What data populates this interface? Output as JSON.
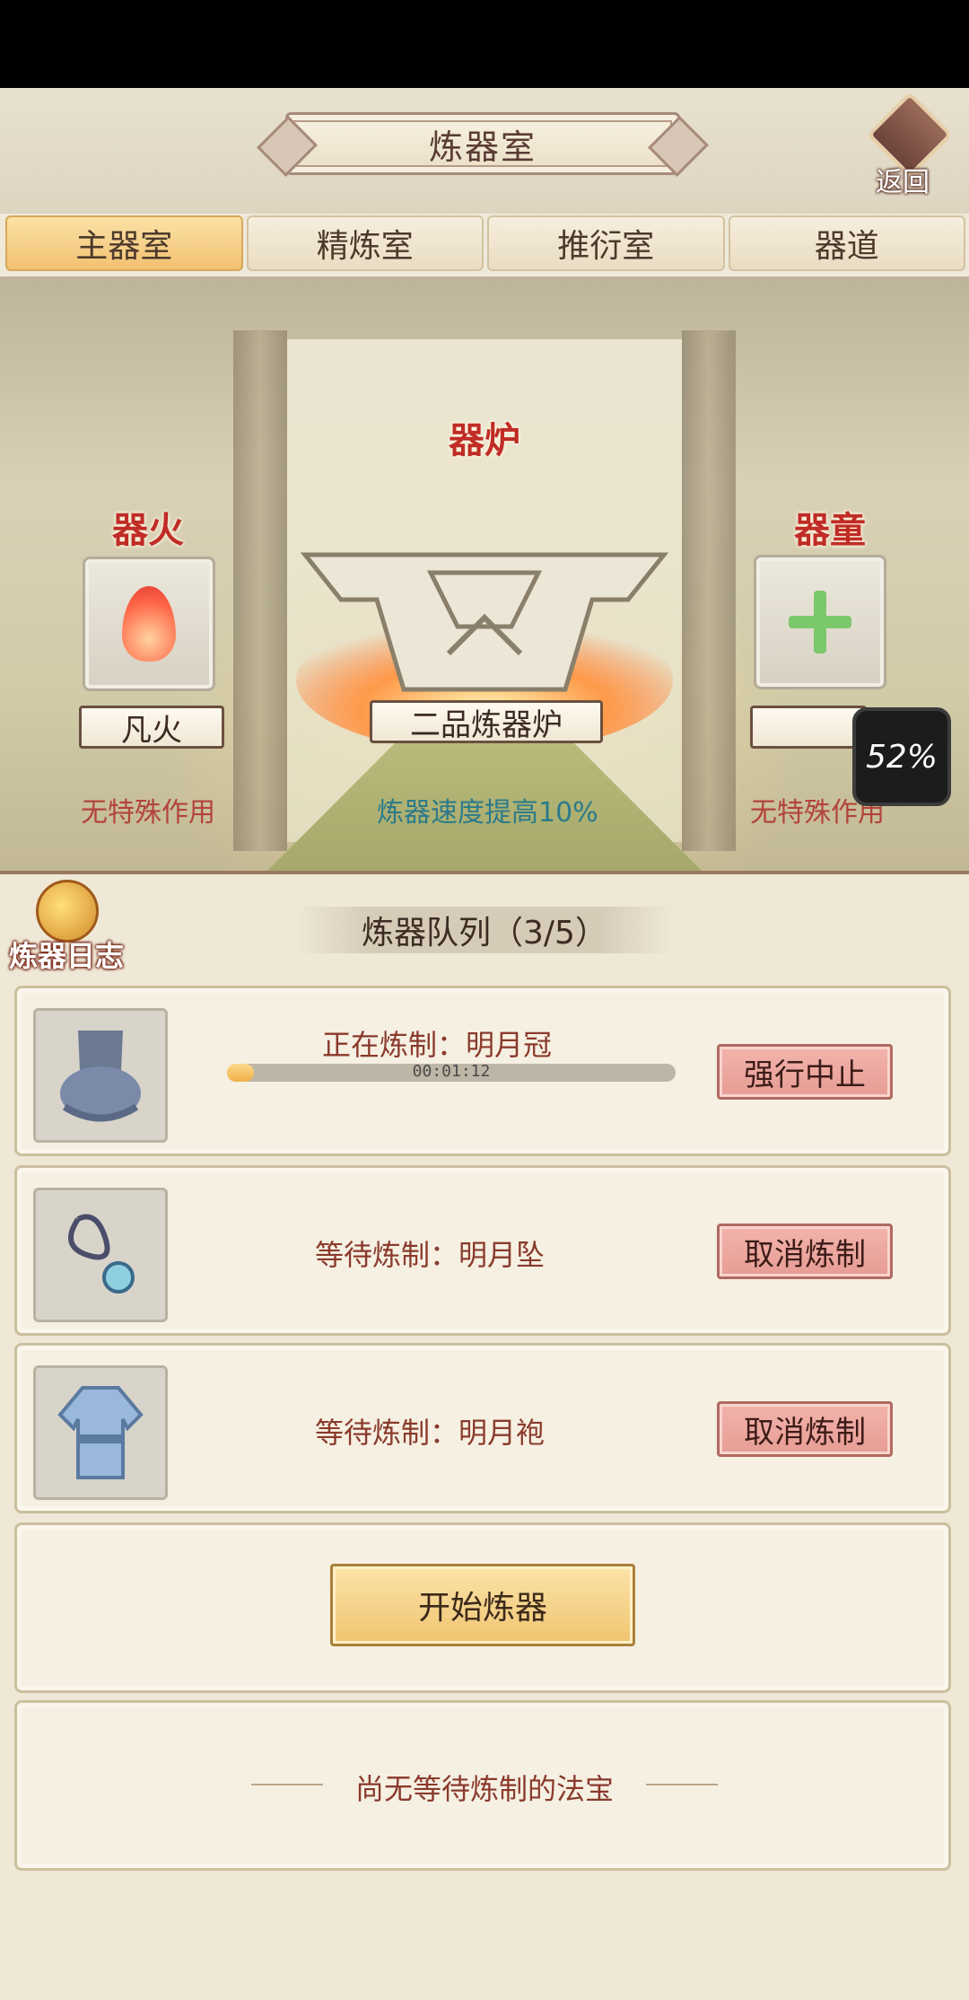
{
  "header": {
    "title": "炼器室",
    "back_label": "返回"
  },
  "tabs": [
    {
      "label": "主器室",
      "active": true
    },
    {
      "label": "精炼室",
      "active": false
    },
    {
      "label": "推衍室",
      "active": false
    },
    {
      "label": "器道",
      "active": false
    }
  ],
  "scene": {
    "fire": {
      "heading": "器火",
      "name": "凡火",
      "effect": "无特殊作用"
    },
    "furnace": {
      "heading": "器炉",
      "name": "二品炼器炉",
      "effect": "炼器速度提高10%"
    },
    "servant": {
      "heading": "器童",
      "name": "",
      "effect": "无特殊作用"
    }
  },
  "overlay_badge": "52%",
  "log": {
    "label": "炼器日志"
  },
  "queue": {
    "title": "炼器队列（3/5）",
    "items": [
      {
        "status": "正在炼制：明月冠",
        "timer": "00:01:12",
        "progress": 0.06,
        "button": "强行中止",
        "icon": "hat-icon"
      },
      {
        "status": "等待炼制：明月坠",
        "button": "取消炼制",
        "icon": "pendant-icon"
      },
      {
        "status": "等待炼制：明月袍",
        "button": "取消炼制",
        "icon": "robe-icon"
      }
    ],
    "start_button": "开始炼器",
    "empty_text": "尚无等待炼制的法宝"
  }
}
